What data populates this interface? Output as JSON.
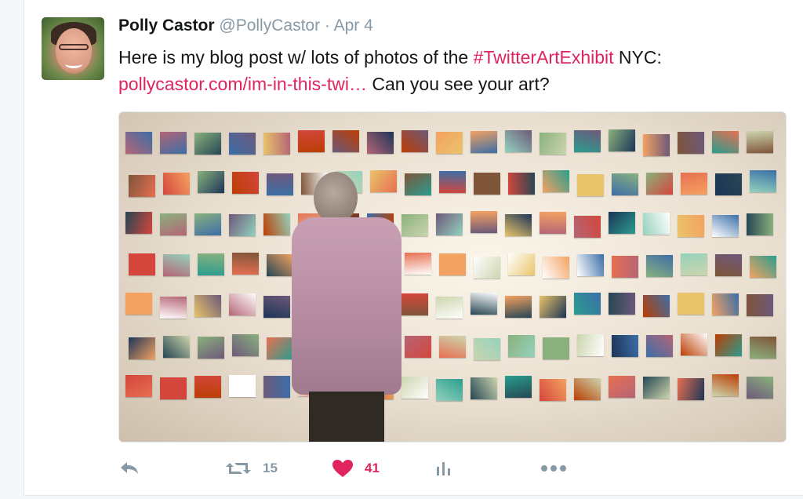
{
  "tweet": {
    "author": {
      "name": "Polly Castor",
      "handle": "@PollyCastor",
      "date": "Apr 4"
    },
    "text": {
      "part1": "Here is my blog post w/ lots of photos of the ",
      "hashtag": "#TwitterArtExhibit",
      "part2": " NYC:",
      "url": "pollycastor.com/im-in-this-twi…",
      "part3": " Can you see your art?"
    },
    "media": {
      "alt": ""
    },
    "actions": {
      "reply_icon": "reply-icon",
      "retweet_icon": "retweet-icon",
      "retweet_count": "15",
      "like_icon": "heart-icon",
      "like_count": "41",
      "analytics_icon": "analytics-icon",
      "more_icon": "more-icon"
    },
    "colors": {
      "accent": "#e0245e",
      "muted": "#8899a6",
      "text": "#14171a"
    }
  }
}
